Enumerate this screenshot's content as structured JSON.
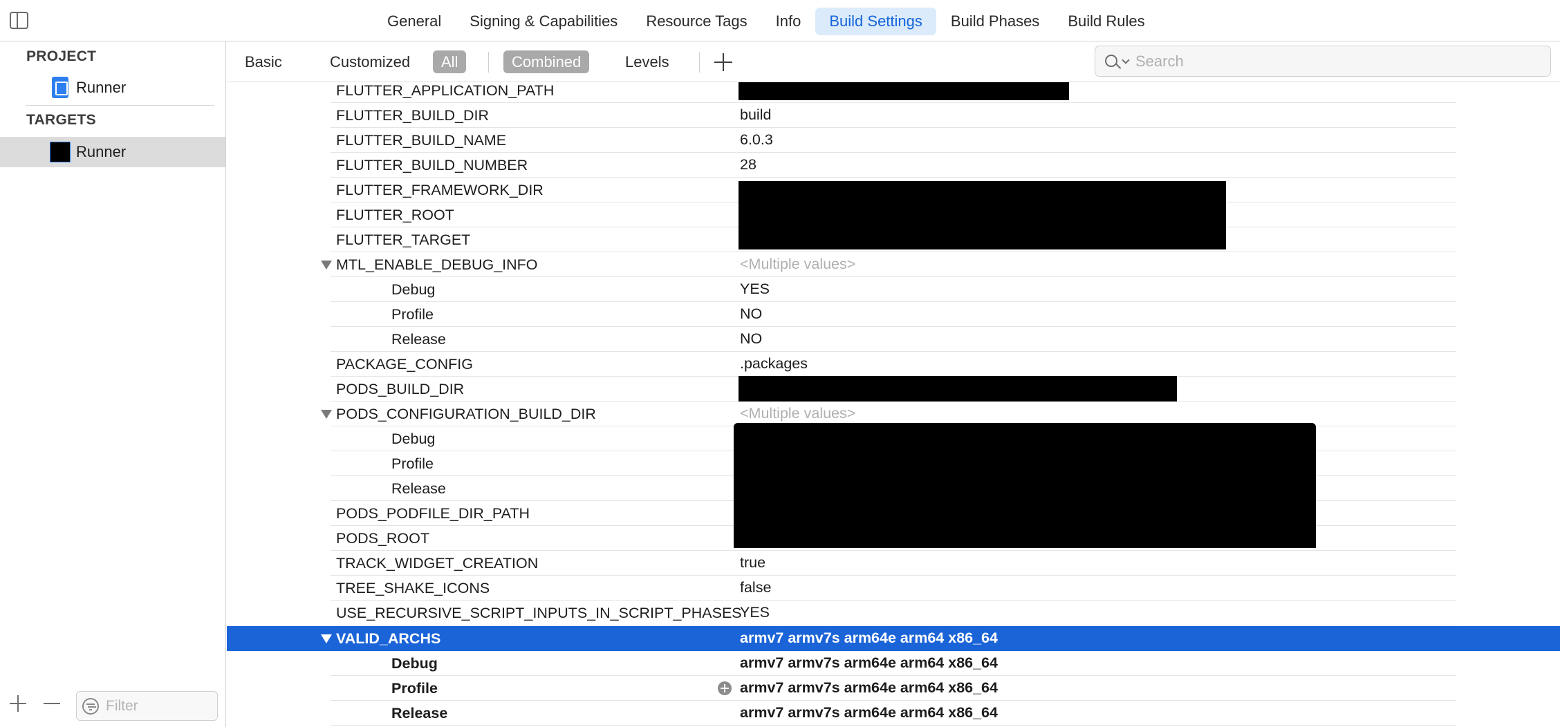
{
  "tabs": [
    "General",
    "Signing & Capabilities",
    "Resource Tags",
    "Info",
    "Build Settings",
    "Build Phases",
    "Build Rules"
  ],
  "active_tab": "Build Settings",
  "navigator": {
    "project_header": "PROJECT",
    "project_item": "Runner",
    "targets_header": "TARGETS",
    "target_item": "Runner",
    "filter_placeholder": "Filter"
  },
  "filterbar": {
    "basic": "Basic",
    "customized": "Customized",
    "all": "All",
    "combined": "Combined",
    "levels": "Levels",
    "search_placeholder": "Search"
  },
  "settings": [
    {
      "name": "FLUTTER_APPLICATION_PATH",
      "value": ""
    },
    {
      "name": "FLUTTER_BUILD_DIR",
      "value": "build"
    },
    {
      "name": "FLUTTER_BUILD_NAME",
      "value": "6.0.3"
    },
    {
      "name": "FLUTTER_BUILD_NUMBER",
      "value": "28"
    },
    {
      "name": "FLUTTER_FRAMEWORK_DIR",
      "value": ""
    },
    {
      "name": "FLUTTER_ROOT",
      "value": ""
    },
    {
      "name": "FLUTTER_TARGET",
      "value": ""
    },
    {
      "name": "MTL_ENABLE_DEBUG_INFO",
      "value": "<Multiple values>"
    },
    {
      "name": "Debug",
      "value": "YES"
    },
    {
      "name": "Profile",
      "value": "NO"
    },
    {
      "name": "Release",
      "value": "NO"
    },
    {
      "name": "PACKAGE_CONFIG",
      "value": ".packages"
    },
    {
      "name": "PODS_BUILD_DIR",
      "value": ""
    },
    {
      "name": "PODS_CONFIGURATION_BUILD_DIR",
      "value": "<Multiple values>"
    },
    {
      "name": "Debug",
      "value": ""
    },
    {
      "name": "Profile",
      "value": ""
    },
    {
      "name": "Release",
      "value": ""
    },
    {
      "name": "PODS_PODFILE_DIR_PATH",
      "value": ""
    },
    {
      "name": "PODS_ROOT",
      "value": ""
    },
    {
      "name": "TRACK_WIDGET_CREATION",
      "value": "true"
    },
    {
      "name": "TREE_SHAKE_ICONS",
      "value": "false"
    },
    {
      "name": "USE_RECURSIVE_SCRIPT_INPUTS_IN_SCRIPT_PHASES",
      "value": "YES"
    },
    {
      "name": "VALID_ARCHS",
      "value": "armv7 armv7s arm64e arm64 x86_64"
    },
    {
      "name": "Debug",
      "value": "armv7 armv7s arm64e arm64 x86_64"
    },
    {
      "name": "Profile",
      "value": "armv7 armv7s arm64e arm64 x86_64"
    },
    {
      "name": "Release",
      "value": "armv7 armv7s arm64e arm64 x86_64"
    }
  ],
  "colors": {
    "selection": "#1b64d8",
    "active_tab_text": "#1464d9",
    "active_tab_bg": "#dcebfb"
  }
}
